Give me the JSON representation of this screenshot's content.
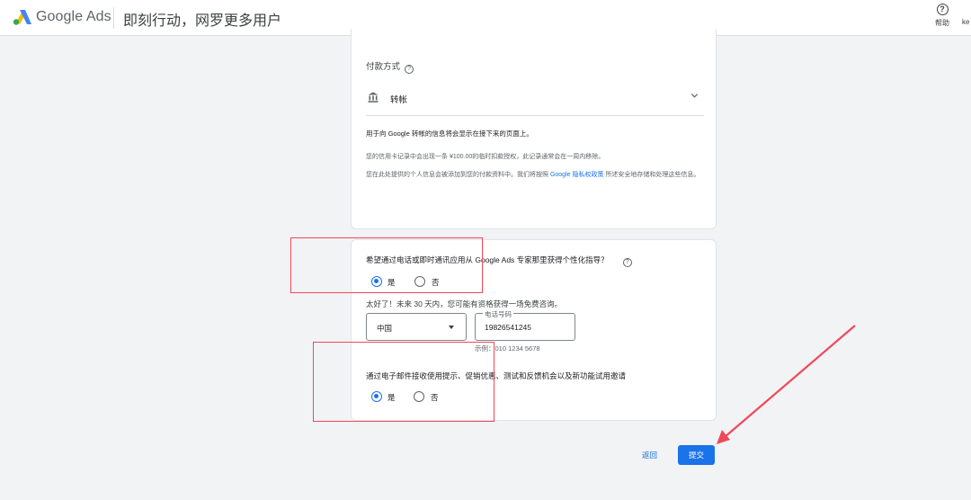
{
  "header": {
    "brand": "Google Ads",
    "tagline": "即刻行动，网罗更多用户",
    "help_label": "帮助",
    "user_truncated": "ke"
  },
  "payment": {
    "label": "付款方式",
    "method": "转帐",
    "notice": "用于向 Google 转帐的信息将会显示在接下来的页面上。",
    "charge_note": "您的信用卡记录中会出现一条 ¥100.00的临时扣款授权，此记录通常会在一周内移除。",
    "privacy_prefix": "您在此处提供的个人信息会被添加到您的付款资料中。我们将按照",
    "privacy_link": "Google 隐私权政策",
    "privacy_suffix": "所述安全地存储和处理这些信息。"
  },
  "consult": {
    "question": "希望通过电话或即时通讯应用从 Google Ads 专家那里获得个性化指导？",
    "yes": "是",
    "no": "否",
    "selected": "是",
    "great": "太好了！未来 30 天内，您可能有资格获得一场免费咨询。",
    "country": "中国",
    "phone_label": "电话号码",
    "phone_value": "19826541245",
    "example": "示例：010 1234 5678"
  },
  "email_opt": {
    "question": "通过电子邮件接收使用提示、促销优惠、测试和反馈机会以及新功能试用邀请",
    "yes": "是",
    "no": "否",
    "selected": "是"
  },
  "actions": {
    "back": "返回",
    "submit": "提交"
  },
  "colors": {
    "accent": "#1a73e8",
    "annotation": "#f0485a"
  }
}
